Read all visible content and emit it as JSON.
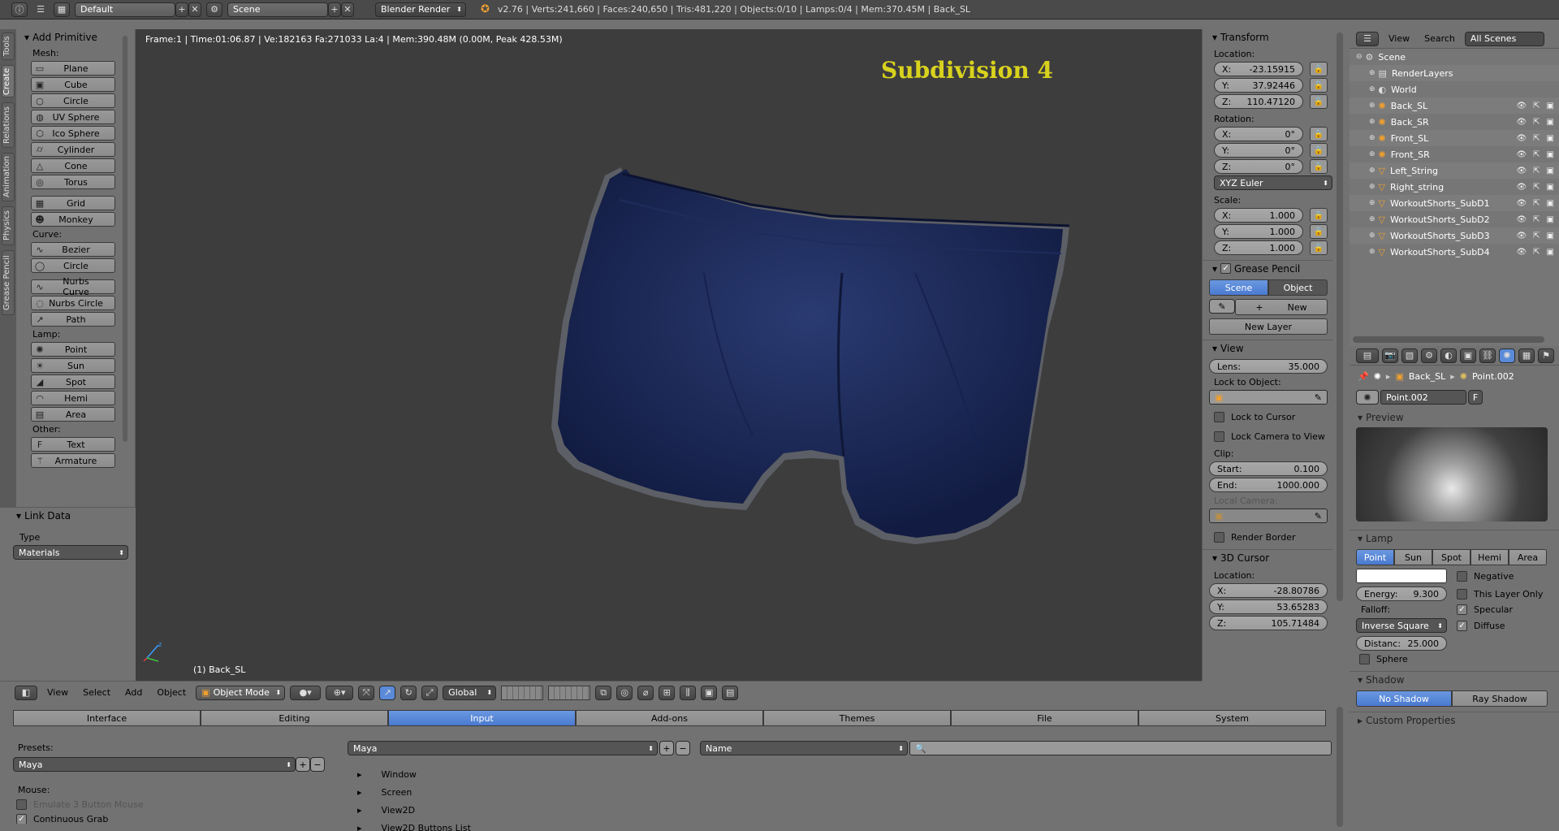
{
  "topbar": {
    "layout": "Default",
    "scene": "Scene",
    "engine": "Blender Render",
    "stats": "v2.76 | Verts:241,660 | Faces:240,650 | Tris:481,220 | Objects:0/10 | Lamps:0/4 | Mem:370.45M | Back_SL"
  },
  "viewport": {
    "info": "Frame:1 | Time:01:06.87 | Ve:182163 Fa:271033 La:4 | Mem:390.48M (0.00M, Peak 428.53M)",
    "overlay_title": "Subdivision 4",
    "object_label": "(1) Back_SL"
  },
  "tabs": [
    "Tools",
    "Create",
    "Relations",
    "Animation",
    "Physics",
    "Grease Pencil"
  ],
  "toolshelf": {
    "panel": "Add Primitive",
    "sections": [
      {
        "label": "Mesh:",
        "items": [
          {
            "label": "Plane",
            "icon": "plane-icon"
          },
          {
            "label": "Cube",
            "icon": "cube-icon"
          },
          {
            "label": "Circle",
            "icon": "circle-icon"
          },
          {
            "label": "UV Sphere",
            "icon": "uv-sphere-icon"
          },
          {
            "label": "Ico Sphere",
            "icon": "ico-sphere-icon"
          },
          {
            "label": "Cylinder",
            "icon": "cylinder-icon"
          },
          {
            "label": "Cone",
            "icon": "cone-icon"
          },
          {
            "label": "Torus",
            "icon": "torus-icon"
          }
        ]
      },
      {
        "label": "",
        "items": [
          {
            "label": "Grid",
            "icon": "grid-icon"
          },
          {
            "label": "Monkey",
            "icon": "monkey-icon"
          }
        ]
      },
      {
        "label": "Curve:",
        "items": [
          {
            "label": "Bezier",
            "icon": "bezier-icon"
          },
          {
            "label": "Circle",
            "icon": "curve-circle-icon"
          }
        ]
      },
      {
        "label": "",
        "items": [
          {
            "label": "Nurbs Curve",
            "icon": "nurbs-curve-icon"
          },
          {
            "label": "Nurbs Circle",
            "icon": "nurbs-circle-icon"
          },
          {
            "label": "Path",
            "icon": "path-icon"
          }
        ]
      },
      {
        "label": "Lamp:",
        "items": [
          {
            "label": "Point",
            "icon": "point-lamp-icon"
          },
          {
            "label": "Sun",
            "icon": "sun-icon"
          },
          {
            "label": "Spot",
            "icon": "spot-icon"
          },
          {
            "label": "Hemi",
            "icon": "hemi-icon"
          },
          {
            "label": "Area",
            "icon": "area-icon"
          }
        ]
      },
      {
        "label": "Other:",
        "items": [
          {
            "label": "Text",
            "icon": "text-icon"
          },
          {
            "label": "Armature",
            "icon": "armature-icon"
          }
        ]
      }
    ],
    "link_data": {
      "title": "Link Data",
      "type_label": "Type",
      "type_value": "Materials"
    }
  },
  "header3d": {
    "menus": [
      "View",
      "Select",
      "Add",
      "Object"
    ],
    "mode": "Object Mode",
    "orientation": "Global"
  },
  "npanel": {
    "transform": "Transform",
    "location_label": "Location:",
    "location": {
      "x": "-23.15915",
      "y": "37.92446",
      "z": "110.47120"
    },
    "rotation_label": "Rotation:",
    "rotation": {
      "x": "0°",
      "y": "0°",
      "z": "0°"
    },
    "rotation_mode": "XYZ Euler",
    "scale_label": "Scale:",
    "scale": {
      "x": "1.000",
      "y": "1.000",
      "z": "1.000"
    },
    "grease_pencil": "Grease Pencil",
    "gp_scene": "Scene",
    "gp_object": "Object",
    "gp_new": "New",
    "gp_new_layer": "New Layer",
    "view": "View",
    "lens_label": "Lens:",
    "lens": "35.000",
    "lock_to_object": "Lock to Object:",
    "lock_to_cursor": "Lock to Cursor",
    "lock_camera": "Lock Camera to View",
    "clip": "Clip:",
    "clip_start_label": "Start:",
    "clip_start": "0.100",
    "clip_end_label": "End:",
    "clip_end": "1000.000",
    "local_camera": "Local Camera:",
    "render_border": "Render Border",
    "cursor": "3D Cursor",
    "cursor_location": "Location:",
    "cursor_x": "-28.80786",
    "cursor_y": "53.65283",
    "cursor_z": "105.71484",
    "axis_x": "X:",
    "axis_y": "Y:",
    "axis_z": "Z:"
  },
  "outliner": {
    "menus": [
      "View",
      "Search"
    ],
    "filter": "All Scenes",
    "items": [
      {
        "label": "Scene",
        "indent": 0,
        "icon": "scene-icon"
      },
      {
        "label": "RenderLayers",
        "indent": 1,
        "icon": "renderlayers-icon"
      },
      {
        "label": "World",
        "indent": 1,
        "icon": "world-icon"
      },
      {
        "label": "Back_SL",
        "indent": 1,
        "icon": "lamp-icon",
        "highlight": true
      },
      {
        "label": "Back_SR",
        "indent": 1,
        "icon": "lamp-icon"
      },
      {
        "label": "Front_SL",
        "indent": 1,
        "icon": "lamp-icon"
      },
      {
        "label": "Front_SR",
        "indent": 1,
        "icon": "lamp-icon"
      },
      {
        "label": "Left_String",
        "indent": 1,
        "icon": "mesh-icon"
      },
      {
        "label": "Right_string",
        "indent": 1,
        "icon": "mesh-icon"
      },
      {
        "label": "WorkoutShorts_SubD1",
        "indent": 1,
        "icon": "mesh-icon"
      },
      {
        "label": "WorkoutShorts_SubD2",
        "indent": 1,
        "icon": "mesh-icon"
      },
      {
        "label": "WorkoutShorts_SubD3",
        "indent": 1,
        "icon": "mesh-icon"
      },
      {
        "label": "WorkoutShorts_SubD4",
        "indent": 1,
        "icon": "mesh-icon"
      }
    ]
  },
  "props": {
    "breadcrumb_obj": "Back_SL",
    "breadcrumb_data": "Point.002",
    "datablock": "Point.002",
    "datablock_flag": "F",
    "preview": "Preview",
    "lamp": "Lamp",
    "lamp_types": [
      "Point",
      "Sun",
      "Spot",
      "Hemi",
      "Area"
    ],
    "negative": "Negative",
    "this_layer_only": "This Layer Only",
    "energy_label": "Energy:",
    "energy": "9.300",
    "specular": "Specular",
    "falloff_label": "Falloff:",
    "diffuse": "Diffuse",
    "falloff": "Inverse Square",
    "distance_label": "Distanc:",
    "distance": "25.000",
    "sphere": "Sphere",
    "shadow": "Shadow",
    "no_shadow": "No Shadow",
    "ray_shadow": "Ray Shadow",
    "custom_properties": "Custom Properties"
  },
  "prefs": {
    "tabs": [
      "Interface",
      "Editing",
      "Input",
      "Add-ons",
      "Themes",
      "File",
      "System"
    ],
    "active_tab": "Input",
    "presets_label": "Presets:",
    "presets": "Maya",
    "keymap": "Maya",
    "search_mode": "Name",
    "mouse_label": "Mouse:",
    "emulate": "Emulate 3 Button Mouse",
    "continuous_grab": "Continuous Grab",
    "tree": [
      "Window",
      "Screen",
      "View2D",
      "View2D Buttons List"
    ]
  },
  "colors": {
    "overlay_title": "#d8d21e",
    "shorts": "#1b2a5a",
    "active_blue": "#5a8ad8"
  }
}
